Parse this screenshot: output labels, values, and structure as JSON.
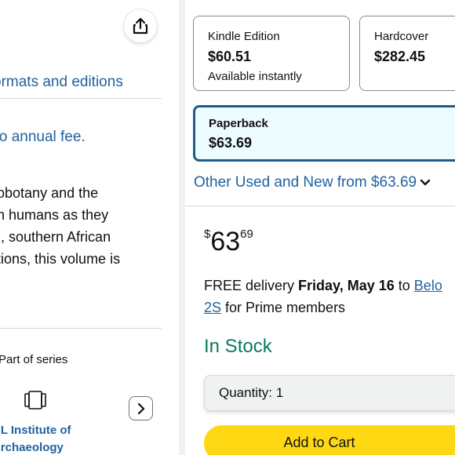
{
  "left": {
    "formats_link": "ll formats and editions",
    "fee_text": "d. No annual fee.",
    "description_lines": [
      "eobotany and the",
      "on humans as they",
      "m, southern African",
      "ations, this volume is"
    ],
    "series_label": "Part of series",
    "series_name_lines": [
      "CL Institute of",
      "Archaeology"
    ],
    "icons": {
      "share": "share-icon",
      "book": "book-icon",
      "next": "chevron-right-icon"
    }
  },
  "formats": [
    {
      "name": "Kindle Edition",
      "price": "$60.51",
      "note": "Available instantly"
    },
    {
      "name": "Hardcover",
      "price": "$282.45"
    },
    {
      "name": "Paperback",
      "price": "$63.69",
      "selected": true
    }
  ],
  "other_used": {
    "text": "Other Used and New from $63.69",
    "icon": "chevron-down-icon"
  },
  "buy_box": {
    "price": {
      "symbol": "$",
      "whole": "63",
      "fraction": "69"
    },
    "delivery": {
      "prefix": "FREE delivery ",
      "date": "Friday, May 16",
      "to": " to ",
      "location_part1": "Belo",
      "location_part2": "2S",
      "suffix": " for Prime members"
    },
    "stock": "In Stock",
    "quantity": "Quantity: 1",
    "add_to_cart": "Add to Cart"
  },
  "colors": {
    "link": "#2162a1",
    "in_stock": "#067d62",
    "add_to_cart": "#ffd814",
    "selected_border": "#1f5d89",
    "selected_bg": "#edfdff"
  }
}
